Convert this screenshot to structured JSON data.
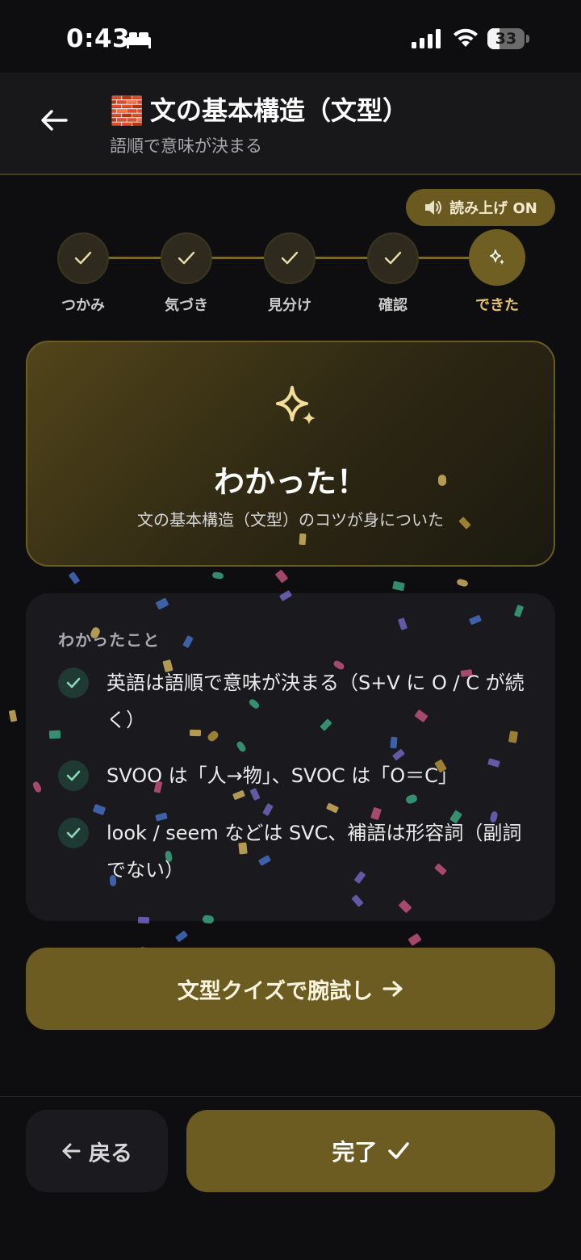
{
  "status_bar": {
    "time": "0:43",
    "battery": "33",
    "battery_level": 0.33
  },
  "header": {
    "back_icon": "arrow-left-icon",
    "emoji": "🧱",
    "title": "文の基本構造（文型）",
    "subtitle": "語順で意味が決まる"
  },
  "read_aloud": {
    "icon": "speaker-icon",
    "label": "読み上げ ON"
  },
  "steps": [
    {
      "label": "つかみ",
      "state": "done"
    },
    {
      "label": "気づき",
      "state": "done"
    },
    {
      "label": "見分け",
      "state": "done"
    },
    {
      "label": "確認",
      "state": "done"
    },
    {
      "label": "できた",
      "state": "current"
    }
  ],
  "success": {
    "icon": "sparkle-icon",
    "title": "わかった！",
    "description": "文の基本構造（文型）のコツが身についた"
  },
  "learnings": {
    "heading": "わかったこと",
    "items": [
      {
        "text": "英語は語順で意味が決まる（S+V に O / C が続く）"
      },
      {
        "text": "SVOO は「人→物」、SVOC は「O＝C」"
      },
      {
        "text": "look / seem などは SVC、補語は形容詞（副詞でない）"
      }
    ]
  },
  "quiz_button": {
    "label": "文型クイズで腕試し",
    "arrow": "→"
  },
  "bottom": {
    "back_label": "戻る",
    "done_label": "完了"
  },
  "colors": {
    "accent": "#6c5c22",
    "accent_text": "#e8c468",
    "check": "#8ad9b8",
    "background": "#0e0e10",
    "card": "#1a1a1e"
  }
}
